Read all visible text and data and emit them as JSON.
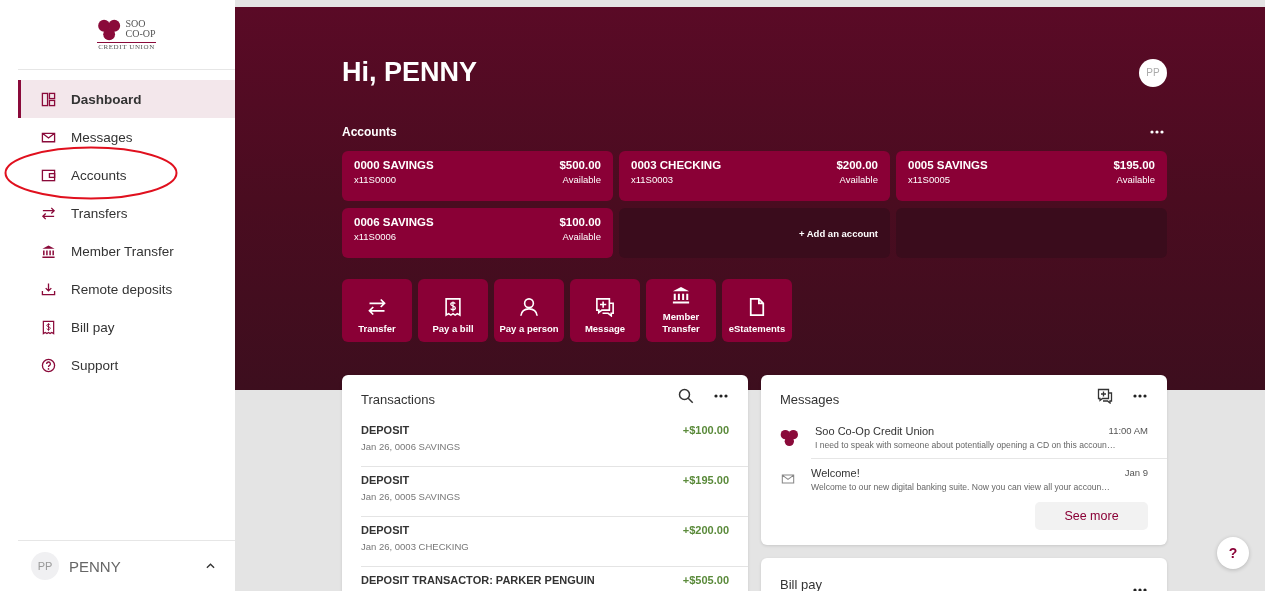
{
  "sidebar": {
    "logo": {
      "line1": "SOO",
      "line2": "CO-OP",
      "line3": "CREDIT UNION"
    },
    "items": [
      {
        "label": "Dashboard",
        "selected": true,
        "circled": false
      },
      {
        "label": "Messages",
        "selected": false,
        "circled": false
      },
      {
        "label": "Accounts",
        "selected": false,
        "circled": true
      },
      {
        "label": "Transfers",
        "selected": false,
        "circled": false
      },
      {
        "label": "Member Transfer",
        "selected": false,
        "circled": false
      },
      {
        "label": "Remote deposits",
        "selected": false,
        "circled": false
      },
      {
        "label": "Bill pay",
        "selected": false,
        "circled": false
      },
      {
        "label": "Support",
        "selected": false,
        "circled": false
      }
    ],
    "user": {
      "initials": "PP",
      "name": "PENNY",
      "expanded": false
    }
  },
  "header": {
    "greeting": "Hi, PENNY",
    "avatar": "PP"
  },
  "accounts": {
    "title": "Accounts",
    "tiles": [
      {
        "kind": "account",
        "name": "0000 SAVINGS",
        "number": "x11S0000",
        "balance": "$500.00",
        "status": "Available"
      },
      {
        "kind": "account",
        "name": "0003 CHECKING",
        "number": "x11S0003",
        "balance": "$200.00",
        "status": "Available"
      },
      {
        "kind": "account",
        "name": "0005 SAVINGS",
        "number": "x11S0005",
        "balance": "$195.00",
        "status": "Available"
      },
      {
        "kind": "account",
        "name": "0006 SAVINGS",
        "number": "x11S0006",
        "balance": "$100.00",
        "status": "Available"
      },
      {
        "kind": "add",
        "label": "+ Add an account"
      },
      {
        "kind": "empty"
      }
    ]
  },
  "actions": [
    {
      "label": "Transfer"
    },
    {
      "label": "Pay a bill"
    },
    {
      "label": "Pay a person"
    },
    {
      "label": "Message"
    },
    {
      "label": "Member Transfer"
    },
    {
      "label": "eStatements"
    }
  ],
  "transactions": {
    "title": "Transactions",
    "rows": [
      {
        "description": "DEPOSIT",
        "detail": "Jan 26, 0006 SAVINGS",
        "amount": "+$100.00"
      },
      {
        "description": "DEPOSIT",
        "detail": "Jan 26, 0005 SAVINGS",
        "amount": "+$195.00"
      },
      {
        "description": "DEPOSIT",
        "detail": "Jan 26, 0003 CHECKING",
        "amount": "+$200.00"
      },
      {
        "description": "DEPOSIT TRANSACTOR: PARKER PENGUIN",
        "amount": "+$505.00"
      }
    ]
  },
  "messages": {
    "title": "Messages",
    "items": [
      {
        "kind": "logo",
        "sender": "Soo Co-Op Credit Union",
        "time": "11:00 AM",
        "preview": "I need to speak with someone about potentially opening a CD on this accoun…"
      },
      {
        "kind": "mail",
        "sender": "Welcome!",
        "time": "Jan 9",
        "preview": "Welcome to our new digital banking suite. Now you can view all your accoun…"
      }
    ],
    "button": "See more"
  },
  "bill_pay": {
    "title": "Bill pay"
  },
  "help_button": "?"
}
